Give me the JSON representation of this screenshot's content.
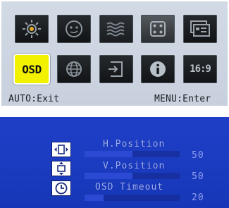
{
  "main_menu": {
    "tiles": [
      {
        "name": "brightness-icon"
      },
      {
        "name": "image-face-icon"
      },
      {
        "name": "waves-icon"
      },
      {
        "name": "color-dice-icon"
      },
      {
        "name": "photo-mode-icon"
      },
      {
        "name": "osd-icon",
        "label": "OSD",
        "selected": true
      },
      {
        "name": "globe-icon"
      },
      {
        "name": "input-source-icon"
      },
      {
        "name": "info-icon"
      },
      {
        "name": "aspect-ratio-icon",
        "label": "16:9"
      }
    ],
    "hint_left": "AUTO:Exit",
    "hint_right": "MENU:Enter"
  },
  "osd_settings": {
    "items": [
      {
        "label": "H.Position",
        "value": "50",
        "level": 0.5,
        "icon": "h-position-icon"
      },
      {
        "label": "V.Position",
        "value": "50",
        "level": 0.5,
        "icon": "v-position-icon"
      },
      {
        "label": "OSD Timeout",
        "value": "20",
        "level": 0.2,
        "icon": "timeout-clock-icon"
      }
    ]
  },
  "colors": {
    "selected_tile": "#f2f200",
    "submenu_bg": "#1f3fc8",
    "submenu_text": "#9fb0f4"
  }
}
